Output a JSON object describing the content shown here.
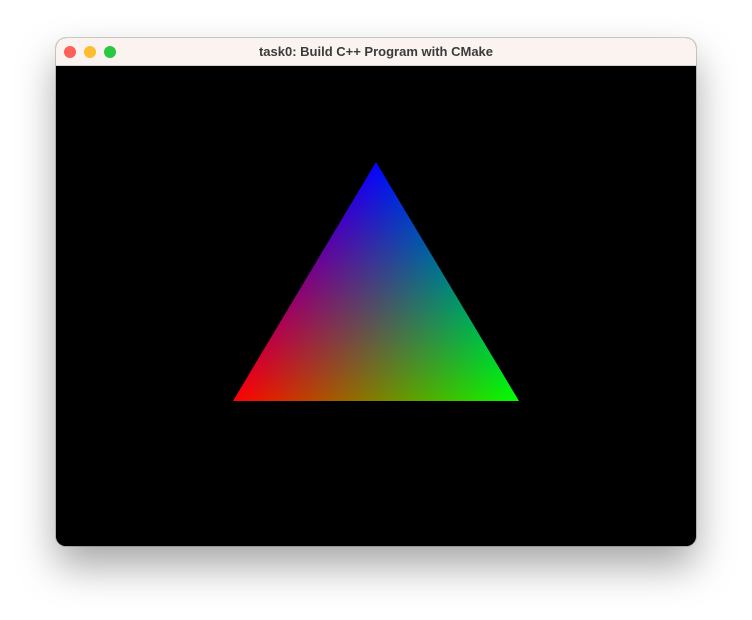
{
  "window": {
    "title": "task0: Build C++ Program with CMake",
    "traffic_lights": {
      "close_color": "#fe5f57",
      "minimize_color": "#febc2e",
      "zoom_color": "#28c840"
    }
  },
  "viewport": {
    "background_color": "#000000",
    "triangle": {
      "vertex_colors": {
        "top": "#0000ff",
        "bottom_left": "#ff0000",
        "bottom_right": "#00ff00"
      }
    }
  }
}
